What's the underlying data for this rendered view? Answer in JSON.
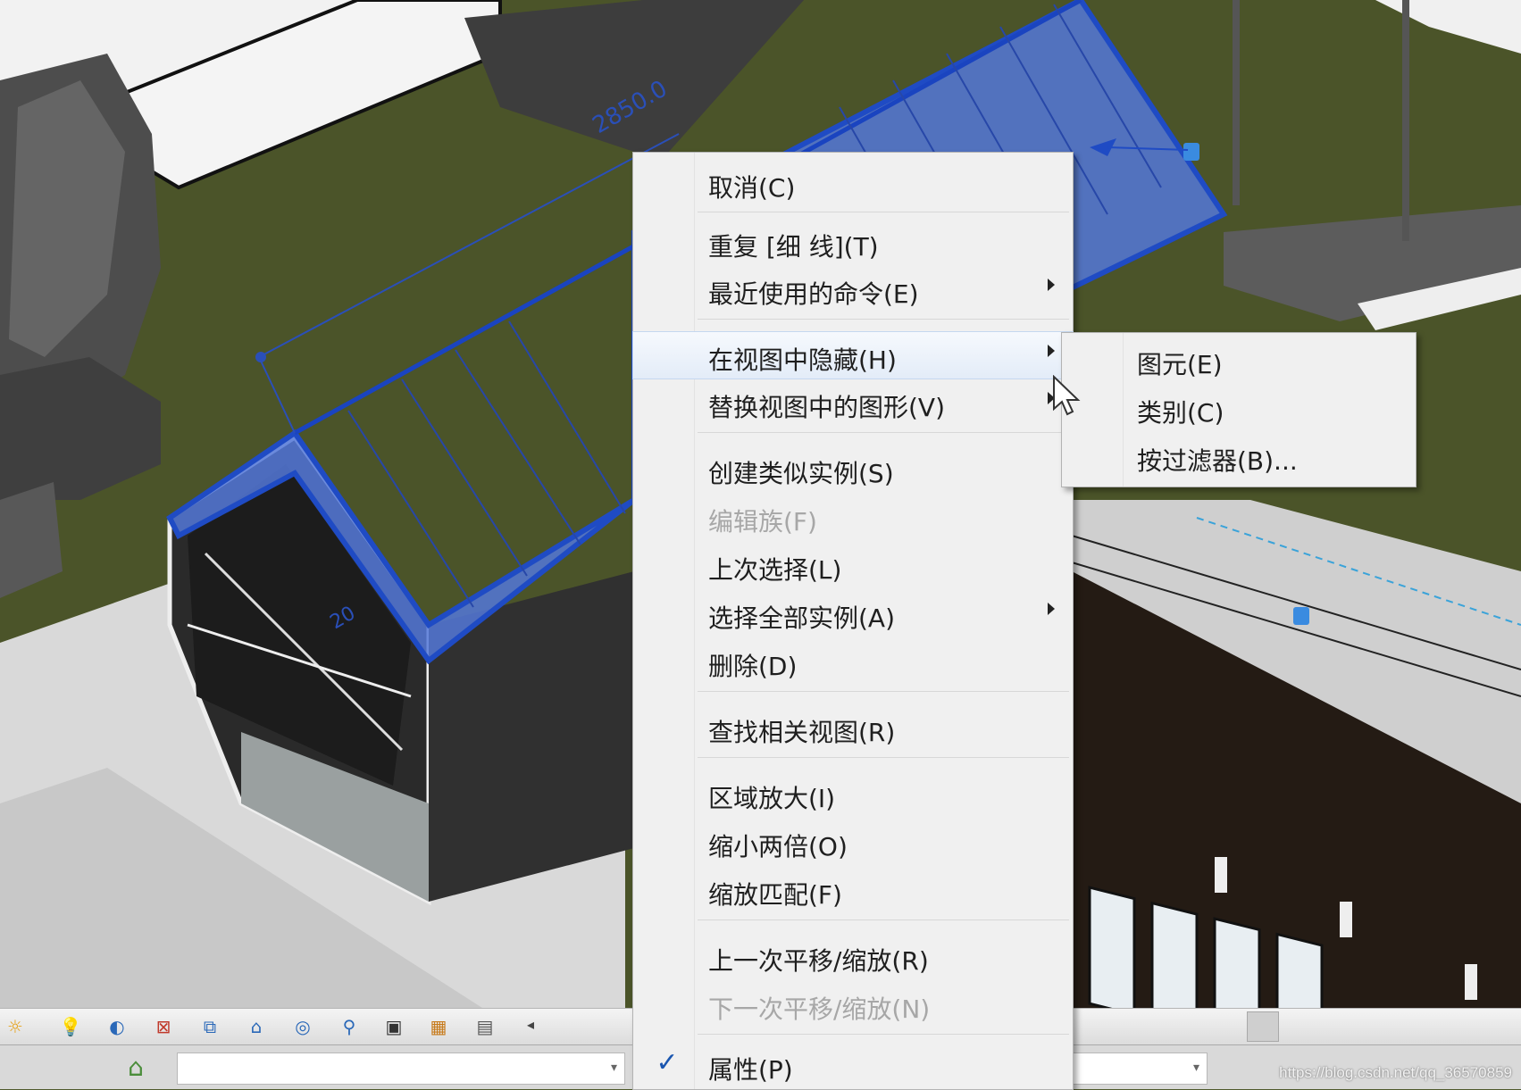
{
  "context_menu": {
    "items": [
      {
        "label": "取消(C)",
        "has_submenu": false,
        "enabled": true
      },
      {
        "label": "重复 [细 线](T)",
        "has_submenu": false,
        "enabled": true
      },
      {
        "label": "最近使用的命令(E)",
        "has_submenu": true,
        "enabled": true
      },
      {
        "label": "在视图中隐藏(H)",
        "has_submenu": true,
        "enabled": true,
        "highlighted": true
      },
      {
        "label": "替换视图中的图形(V)",
        "has_submenu": true,
        "enabled": true
      },
      {
        "label": "创建类似实例(S)",
        "has_submenu": false,
        "enabled": true
      },
      {
        "label": "编辑族(F)",
        "has_submenu": false,
        "enabled": false
      },
      {
        "label": "上次选择(L)",
        "has_submenu": false,
        "enabled": true
      },
      {
        "label": "选择全部实例(A)",
        "has_submenu": true,
        "enabled": true
      },
      {
        "label": "删除(D)",
        "has_submenu": false,
        "enabled": true
      },
      {
        "label": "查找相关视图(R)",
        "has_submenu": false,
        "enabled": true
      },
      {
        "label": "区域放大(I)",
        "has_submenu": false,
        "enabled": true
      },
      {
        "label": "缩小两倍(O)",
        "has_submenu": false,
        "enabled": true
      },
      {
        "label": "缩放匹配(F)",
        "has_submenu": false,
        "enabled": true
      },
      {
        "label": "上一次平移/缩放(R)",
        "has_submenu": false,
        "enabled": true
      },
      {
        "label": "下一次平移/缩放(N)",
        "has_submenu": false,
        "enabled": false
      },
      {
        "label": "属性(P)",
        "has_submenu": false,
        "enabled": true,
        "checked": true
      }
    ]
  },
  "submenu": {
    "items": [
      {
        "label": "图元(E)"
      },
      {
        "label": "类别(C)"
      },
      {
        "label": "按过滤器(B)..."
      }
    ]
  },
  "viewport": {
    "dimension_label": "2850.0",
    "dimension_label_2": "20"
  },
  "view_control_bar": {
    "icons": [
      "sun-path-icon",
      "light-bulb-icon",
      "shadows-icon",
      "crop-view-icon",
      "show-crop-icon",
      "temporary-hide-icon",
      "reveal-hidden-icon",
      "lock-3d-icon",
      "pin-icon",
      "worksharing-icon",
      "analysis-icon",
      "render-icon"
    ]
  },
  "status_bar": {
    "watermark": "https://blog.csdn.net/qq_36570859"
  },
  "colors": {
    "menu_bg": "#f0f0f0",
    "selection_blue": "#2f5fd0",
    "grass": "#4f5a2c"
  }
}
